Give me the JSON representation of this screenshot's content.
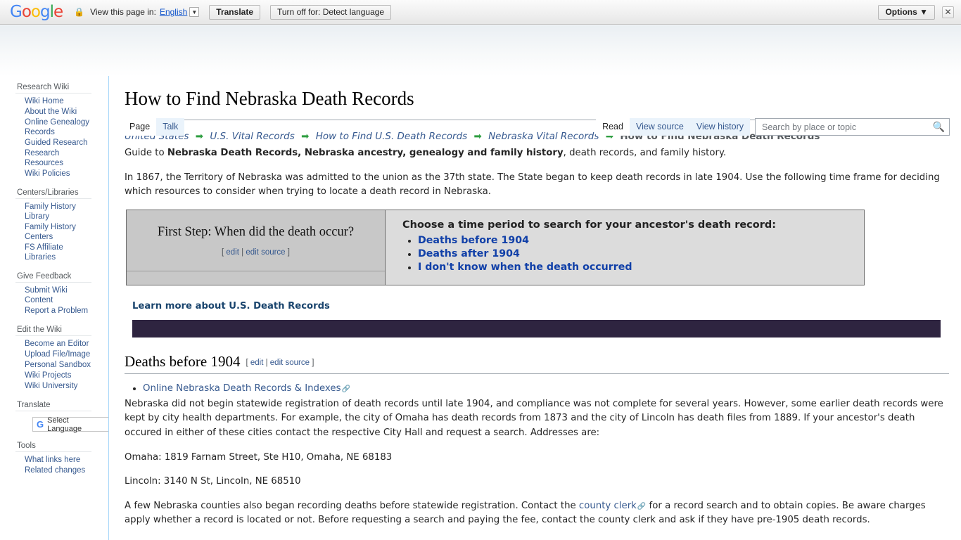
{
  "translate_bar": {
    "logo": "Google",
    "lock_icon": "lock-icon",
    "view_page_label": "View this page in:",
    "language_value": "English",
    "translate_button": "Translate",
    "turn_off_button": "Turn off for: Detect language",
    "options_button": "Options ▼",
    "close_icon": "✕"
  },
  "sidebar": {
    "groups": [
      {
        "heading": "Research Wiki",
        "items": [
          "Wiki Home",
          "About the Wiki",
          "Online Genealogy Records",
          "Guided Research",
          "Research Resources",
          "Wiki Policies"
        ]
      },
      {
        "heading": "Centers/Libraries",
        "items": [
          "Family History Library",
          "Family History Centers",
          "FS Affiliate Libraries"
        ]
      },
      {
        "heading": "Give Feedback",
        "items": [
          "Submit Wiki Content",
          "Report a Problem"
        ]
      },
      {
        "heading": "Edit the Wiki",
        "items": [
          "Become an Editor",
          "Upload File/Image",
          "Personal Sandbox",
          "Wiki Projects",
          "Wiki University"
        ]
      },
      {
        "heading": "Translate",
        "items": []
      },
      {
        "heading": "Tools",
        "items": [
          "What links here",
          "Related changes"
        ]
      }
    ],
    "select_language_button": "Select Language",
    "select_language_icon": "google-g-icon"
  },
  "header": {
    "title": "How to Find Nebraska Death Records",
    "tabs_left": [
      {
        "label": "Page",
        "selected": true
      },
      {
        "label": "Talk",
        "selected": false
      }
    ],
    "tabs_right": [
      {
        "label": "Read",
        "selected": true
      },
      {
        "label": "View source",
        "selected": false
      },
      {
        "label": "View history",
        "selected": false
      }
    ],
    "search": {
      "placeholder": "Search by place or topic",
      "value": "",
      "icon": "search-icon"
    }
  },
  "breadcrumb": {
    "separator": "➡",
    "items": [
      "United States",
      "U.S. Vital Records",
      "How to Find U.S. Death Records",
      "Nebraska Vital Records"
    ],
    "current": "How to Find Nebraska Death Records"
  },
  "main": {
    "intro_prefix": "Guide to ",
    "intro_bold": "Nebraska Death Records, Nebraska ancestry, genealogy and family history",
    "intro_suffix": ", death records, and family history.",
    "paragraph_1": "In 1867, the Territory of Nebraska was admitted to the union as the 37th state. The State began to keep death records in late 1904. Use the following time frame for deciding which resources to consider when trying to locate a death record in Nebraska.",
    "choose_box": {
      "left_title": "First Step: When did the death occur?",
      "left_edit": "[ edit | edit source ]",
      "left_edit_1": "edit",
      "left_edit_2": "edit source",
      "right_heading": "Choose a time period to search for your ancestor's death record:",
      "options": [
        "Deaths before 1904",
        "Deaths after 1904",
        "I don't know when the death occurred"
      ]
    },
    "learn_more": "Learn more about U.S. Death Records",
    "banner_color": "#2e2440",
    "section": {
      "title": "Deaths before 1904",
      "edit_1": "edit",
      "edit_2": "edit source",
      "link_bullet": "Online Nebraska Death Records & Indexes",
      "paragraph_2": "Nebraska did not begin statewide registration of death records until late 1904, and compliance was not complete for several years.  However, some earlier death records were kept by city health departments.  For example, the city of Omaha has death records from 1873 and the city of Lincoln has death files from 1889.  If your ancestor's death occured in either of these cities contact the respective City Hall and request a search. Addresses are:",
      "address_omaha": "Omaha: 1819 Farnam Street, Ste H10, Omaha, NE 68183",
      "address_lincoln": "Lincoln: 3140 N St, Lincoln, NE 68510",
      "paragraph_3_a": "A few Nebraska counties also began recording deaths before statewide registration.  Contact the ",
      "paragraph_3_link": "county clerk",
      "paragraph_3_b": " for a record search and to obtain copies. Be aware charges apply whether a record is located or not.  Before requesting a search and paying the fee, contact the county clerk and ask if they have pre-1905 death records."
    }
  }
}
